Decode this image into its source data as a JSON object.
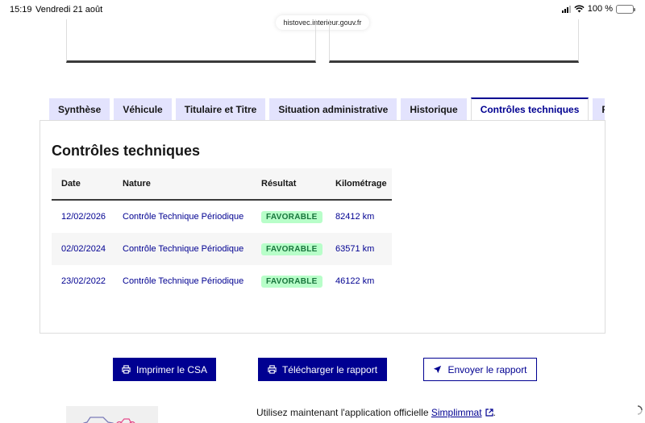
{
  "status_bar": {
    "time": "15:19",
    "date": "Vendredi 21 août",
    "battery": "100 %"
  },
  "browser": {
    "url": "histovec.interieur.gouv.fr"
  },
  "tabs": [
    {
      "label": "Synthèse",
      "active": false
    },
    {
      "label": "Véhicule",
      "active": false
    },
    {
      "label": "Titulaire et Titre",
      "active": false
    },
    {
      "label": "Situation administrative",
      "active": false
    },
    {
      "label": "Historique",
      "active": false
    },
    {
      "label": "Contrôles techniques",
      "active": true
    },
    {
      "label": "Rap",
      "active": false
    }
  ],
  "panel": {
    "title": "Contrôles techniques",
    "table": {
      "headers": {
        "date": "Date",
        "nature": "Nature",
        "result": "Résultat",
        "km": "Kilométrage"
      },
      "rows": [
        {
          "date": "12/02/2026",
          "nature": "Contrôle Technique Périodique",
          "result": "FAVORABLE",
          "km": "82412 km"
        },
        {
          "date": "02/02/2024",
          "nature": "Contrôle Technique Périodique",
          "result": "FAVORABLE",
          "km": "63571 km"
        },
        {
          "date": "23/02/2022",
          "nature": "Contrôle Technique Périodique",
          "result": "FAVORABLE",
          "km": "46122 km"
        }
      ]
    }
  },
  "actions": {
    "print_label": "Imprimer le CSA",
    "download_label": "Télécharger le rapport",
    "send_label": "Envoyer le rapport"
  },
  "promo": {
    "text_before": "Utilisez maintenant l'application officielle",
    "link_label": "Simplimmat",
    "text_after": "."
  },
  "colors": {
    "primary": "#000091",
    "tab_bg": "#e3e3fd",
    "success_bg": "#b8fec9",
    "success_text": "#18753c"
  }
}
